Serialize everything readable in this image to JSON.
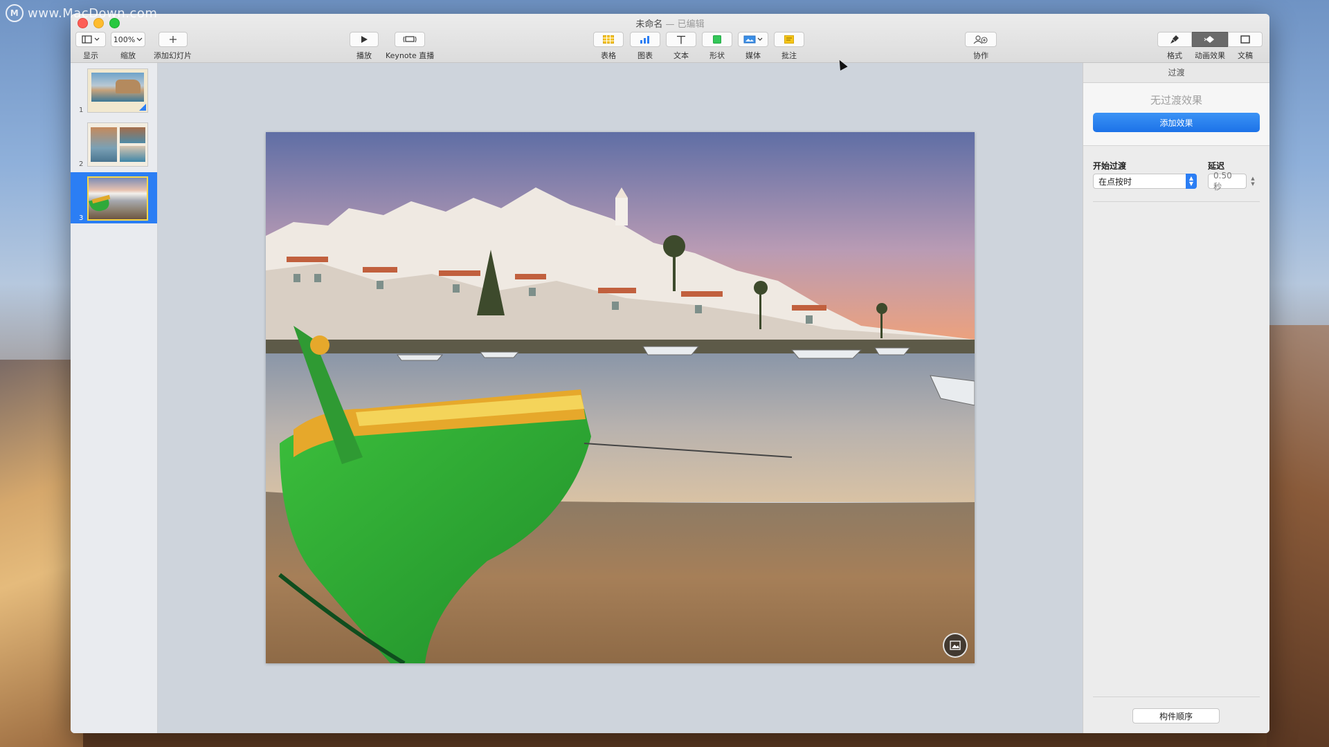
{
  "watermark": {
    "icon_letter": "M",
    "text": "www.MacDown.com"
  },
  "window": {
    "title": "未命名",
    "title_sep": " — ",
    "title_status": "已编辑"
  },
  "toolbar": {
    "view": {
      "label": "显示",
      "icon": "sidebar-view-icon"
    },
    "zoom": {
      "value": "100%",
      "label": "缩放"
    },
    "add_slide": {
      "label": "添加幻灯片",
      "icon": "plus-icon"
    },
    "play": {
      "label": "播放",
      "icon": "play-icon"
    },
    "keynote_live": {
      "label": "Keynote 直播",
      "icon": "keynote-live-icon"
    },
    "table": {
      "label": "表格",
      "icon": "table-icon",
      "color": "#f4c21a"
    },
    "chart": {
      "label": "图表",
      "icon": "chart-icon",
      "color": "#2b7ef4"
    },
    "text": {
      "label": "文本",
      "icon": "text-icon"
    },
    "shape": {
      "label": "形状",
      "icon": "shape-icon",
      "color": "#34c759"
    },
    "media": {
      "label": "媒体",
      "icon": "media-icon",
      "color": "#3a8ee6"
    },
    "comment": {
      "label": "批注",
      "icon": "comment-icon",
      "color": "#f5c518"
    },
    "collaborate": {
      "label": "协作",
      "icon": "collaborate-icon"
    },
    "format": {
      "label": "格式",
      "icon": "paintbrush-icon"
    },
    "animate": {
      "label": "动画效果",
      "icon": "animate-diamond-icon"
    },
    "document": {
      "label": "文稿",
      "icon": "document-icon"
    }
  },
  "slides": [
    {
      "number": "1"
    },
    {
      "number": "2"
    },
    {
      "number": "3"
    }
  ],
  "inspector": {
    "header": "过渡",
    "no_effect": "无过渡效果",
    "add_effect": "添加效果",
    "start_transition_label": "开始过渡",
    "start_transition_value": "在点按时",
    "delay_label": "延迟",
    "delay_value": "0.50 秒",
    "build_order": "构件顺序"
  },
  "colors": {
    "accent": "#2b7ef4",
    "selection": "#2b7ef4"
  }
}
